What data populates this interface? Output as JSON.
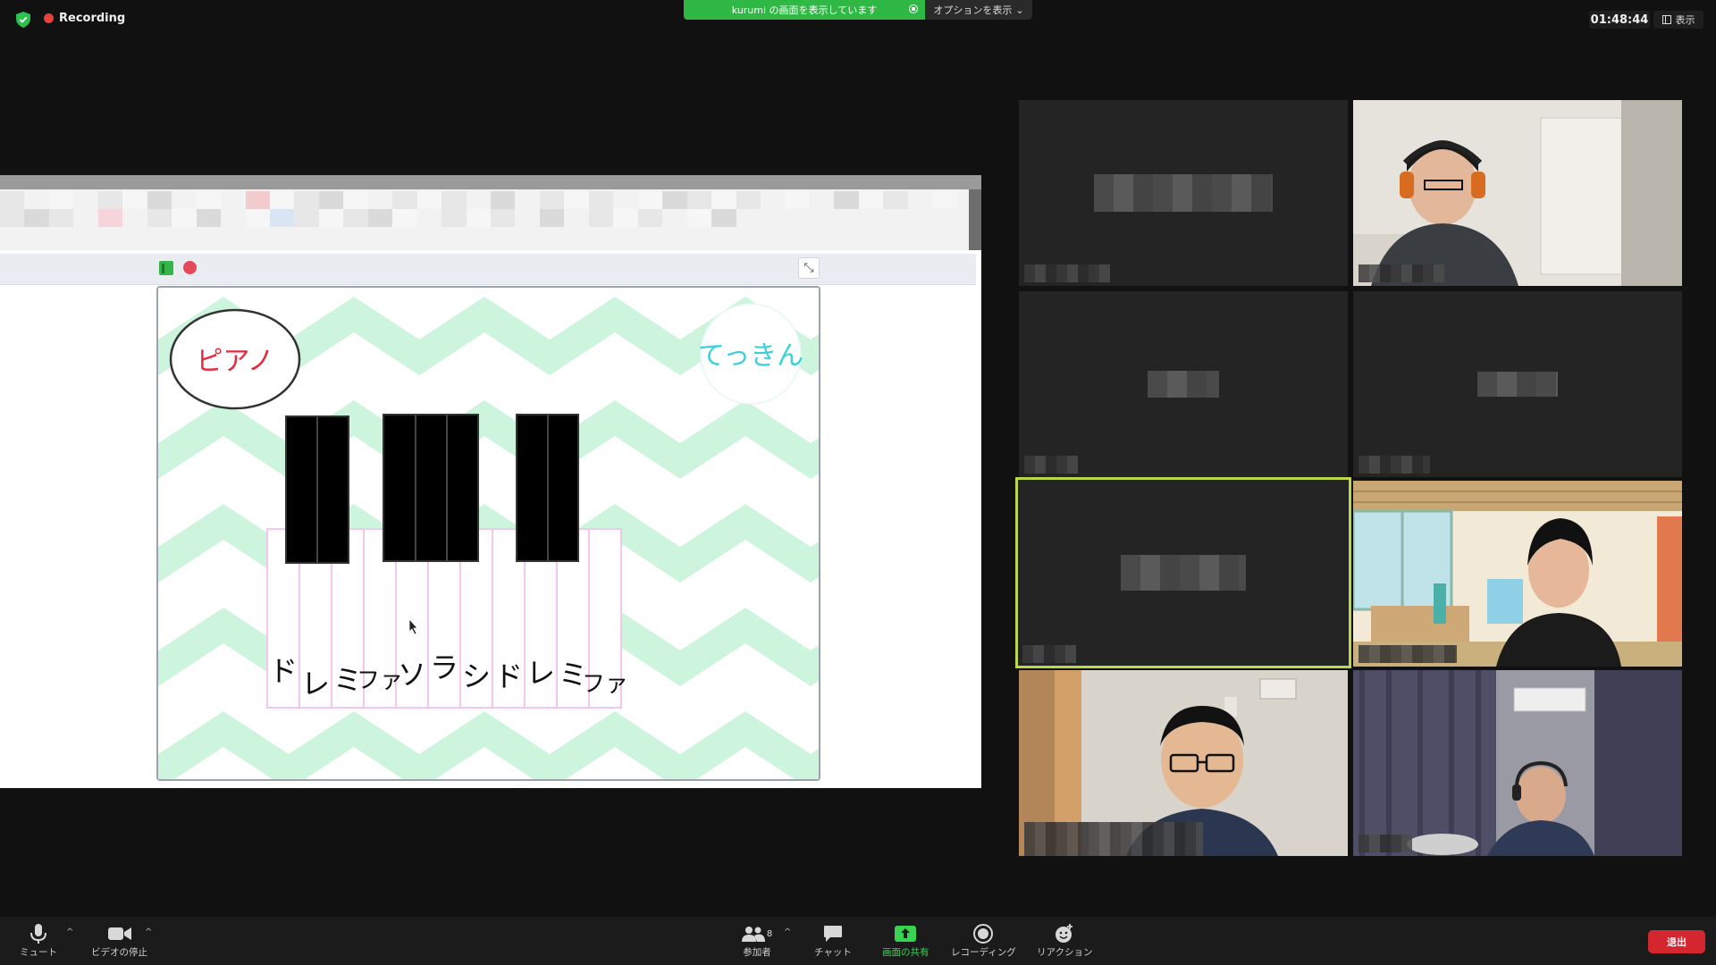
{
  "top_bar": {
    "recording_label": "Recording",
    "share_banner": "kurumi の画面を表示しています",
    "options_label": "オプションを表示",
    "timer": "01:48:44",
    "view_label": "表示"
  },
  "stage": {
    "piano_label": "ピアノ",
    "tekkin_label": "てっきん",
    "note_labels": [
      "ド",
      "レ",
      "ミ",
      "ファ",
      "ソ",
      "ラ",
      "シ",
      "ド",
      "レ",
      "ミ",
      "ファ"
    ]
  },
  "toolbar": {
    "mute": "ミュート",
    "stop_video": "ビデオの停止",
    "participants": "参加者",
    "participant_count": "8",
    "chat": "チャット",
    "share_screen": "画面の共有",
    "recording": "レコーディング",
    "reactions": "リアクション",
    "leave": "退出"
  },
  "colors": {
    "recording_red": "#e8403a",
    "share_green": "#2fb944",
    "active_speaker_border": "#b9d84d",
    "leave_red": "#d3262f",
    "stage_chevron": "#cdf5dd"
  }
}
